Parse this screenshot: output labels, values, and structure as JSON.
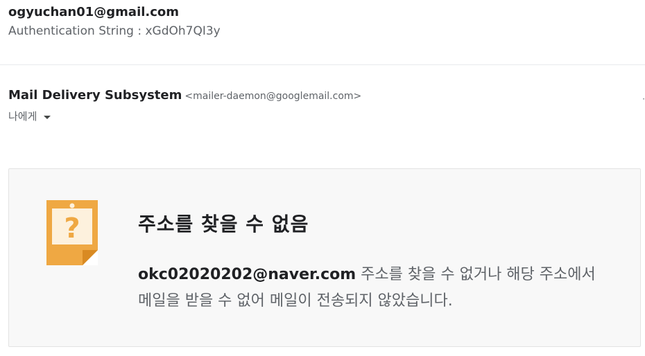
{
  "previous_message": {
    "email": "ogyuchan01@gmail.com",
    "auth_string": "Authentication String : xGdOh7QI3y"
  },
  "message": {
    "sender_name": "Mail Delivery Subsystem",
    "sender_address": "<mailer-daemon@googlemail.com>",
    "recipient_label": "나에게",
    "edge_mark": "·"
  },
  "bounce_card": {
    "icon": "question-note-icon",
    "title": "주소를 찾을 수 없음",
    "failed_address": "okc02020202@naver.com",
    "description_line1": " 주소를 찾을 수 없거나 해당 주소에서",
    "description_line2": "메일을 받을 수 없어 메일이 전송되지 않았습니다."
  },
  "colors": {
    "icon_orange": "#efa843",
    "icon_paper": "#fdf1dd",
    "card_bg": "#f8f8f8"
  }
}
